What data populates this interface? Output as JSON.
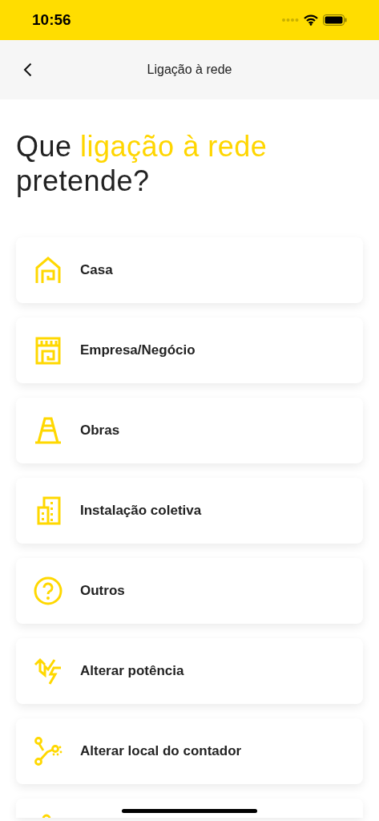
{
  "status_bar": {
    "time": "10:56"
  },
  "nav": {
    "title": "Ligação à rede"
  },
  "heading": [
    {
      "text": "Que ",
      "highlight": false
    },
    {
      "text": "ligação à rede",
      "highlight": true
    },
    {
      "text": " pretende?",
      "highlight": false
    }
  ],
  "options": [
    {
      "kind": "house",
      "label": "Casa"
    },
    {
      "kind": "shop",
      "label": "Empresa/Negócio"
    },
    {
      "kind": "cone",
      "label": "Obras"
    },
    {
      "kind": "building",
      "label": "Instalação coletiva"
    },
    {
      "kind": "question",
      "label": "Outros"
    },
    {
      "kind": "power",
      "label": "Alterar potência"
    },
    {
      "kind": "route",
      "label": "Alterar local do contador"
    },
    {
      "kind": "partial"
    }
  ]
}
